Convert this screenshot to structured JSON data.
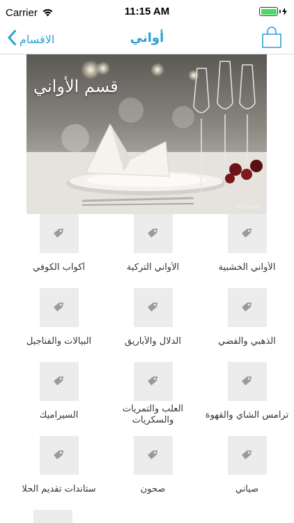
{
  "status_bar": {
    "carrier": "Carrier",
    "time": "11:15 AM"
  },
  "nav": {
    "back_label": "الاقسام",
    "title": "أواني",
    "accent_color": "#2a9fd6"
  },
  "banner": {
    "title": "قسم الأواني",
    "credit": "Alkhareeh"
  },
  "categories": [
    {
      "label": "الأواني الخشبية"
    },
    {
      "label": "الأواني التركية"
    },
    {
      "label": "أكواب الكوفي"
    },
    {
      "label": "الذهبي والفضي"
    },
    {
      "label": "الدلال والأباريق"
    },
    {
      "label": "البيالات والفناجيل"
    },
    {
      "label": "ترامس الشاي والقهوة"
    },
    {
      "label": "العلب والتمريات والسكريات"
    },
    {
      "label": "السيراميك"
    },
    {
      "label": "صياني"
    },
    {
      "label": "صحون"
    },
    {
      "label": "ستاندات تقديم الحلا"
    }
  ],
  "icons": {
    "thumb_placeholder": "tag-icon",
    "cart": "shopping-bag-icon",
    "back": "chevron-left-icon"
  }
}
